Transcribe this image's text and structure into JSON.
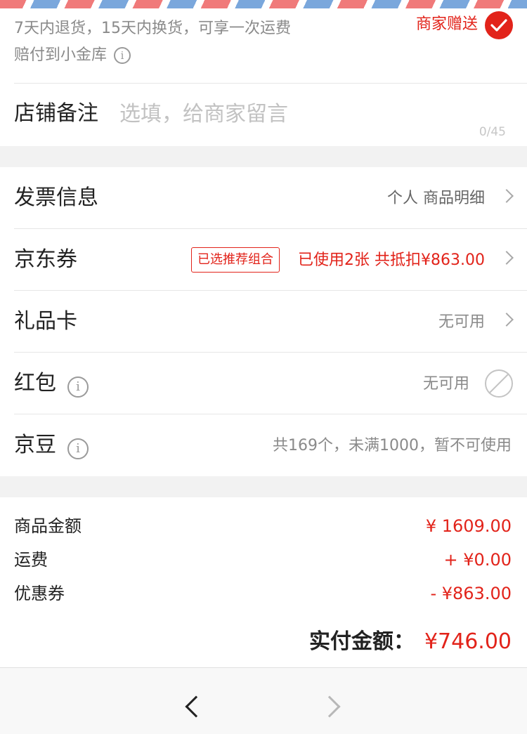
{
  "delivery": {
    "return_policy_line1": "7天内退货，15天内换货，可享一次运费",
    "return_policy_line2": "赔付到小金库",
    "info_icon": "i",
    "gift_label": "商家赠送",
    "gift_checked": true,
    "gift_icon": "check-circle-icon"
  },
  "remark": {
    "label": "店铺备注",
    "placeholder": "选填，给商家留言",
    "value": "",
    "counter": "0/45"
  },
  "options": {
    "invoice": {
      "label": "发票信息",
      "value": "个人 商品明细"
    },
    "coupon": {
      "label": "京东券",
      "tag": "已选推荐组合",
      "value": "已使用2张 共抵扣¥863.00"
    },
    "gift_card": {
      "label": "礼品卡",
      "value": "无可用"
    },
    "red_packet": {
      "label": "红包",
      "value": "无可用"
    },
    "jd_beans": {
      "label": "京豆",
      "value": "共169个，未满1000，暂不可使用"
    }
  },
  "totals": {
    "goods": {
      "label": "商品金额",
      "value": "¥ 1609.00"
    },
    "shipping": {
      "label": "运费",
      "value": "+ ¥0.00"
    },
    "coupon": {
      "label": "优惠券",
      "value": "- ¥863.00"
    },
    "pay": {
      "label": "实付金额：",
      "value": "¥746.00"
    }
  },
  "colors": {
    "accent": "#e2231a",
    "airmail_red": "#f07a7a",
    "airmail_blue": "#7aa7dc"
  },
  "nav": {
    "back_icon": "chevron-left-icon",
    "forward_icon": "chevron-right-icon"
  }
}
